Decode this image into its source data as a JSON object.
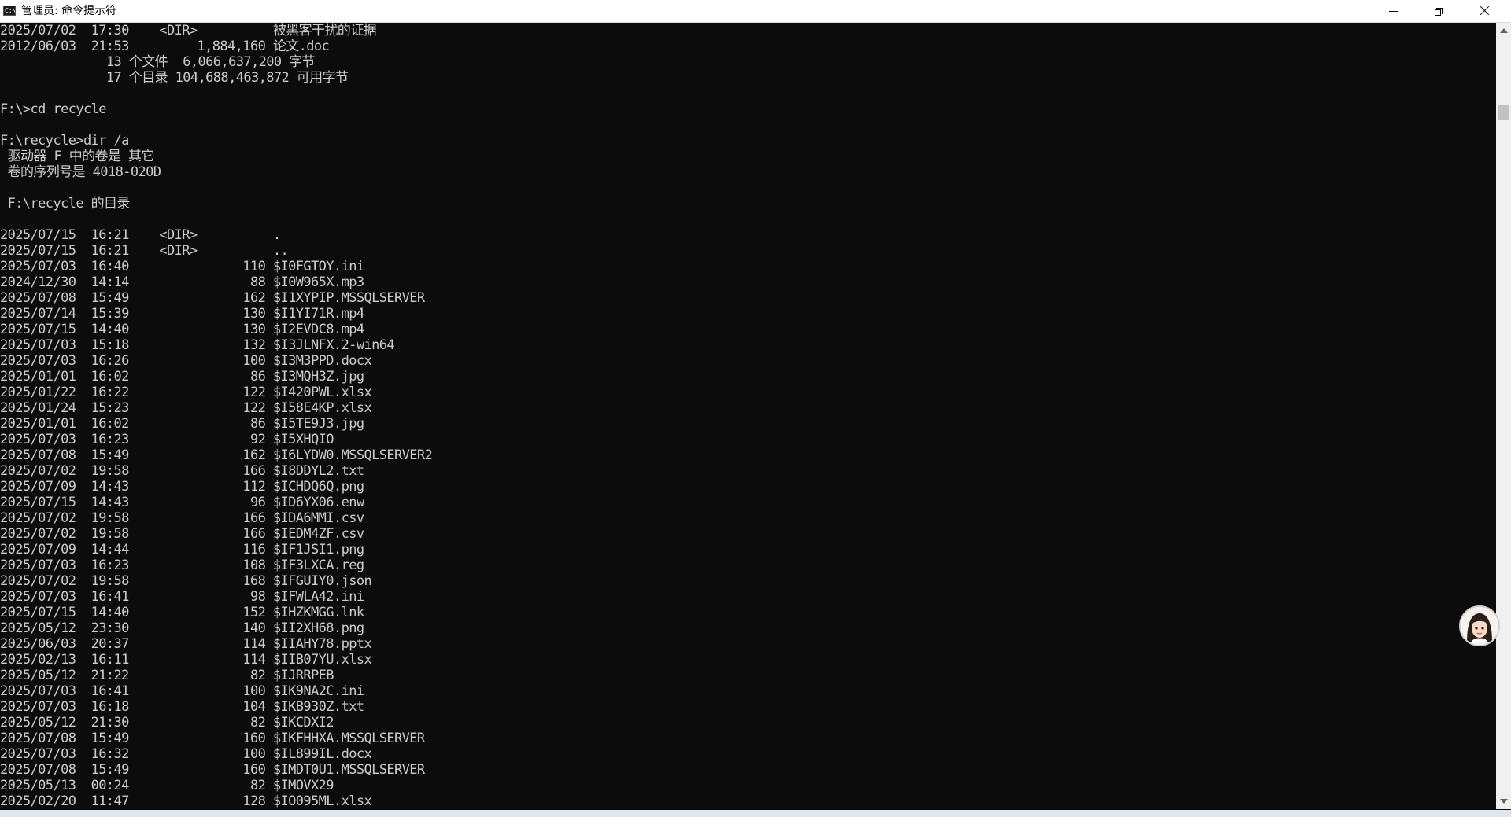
{
  "window": {
    "title": "管理员: 命令提示符",
    "app_icon_text": "C:\\",
    "icons": {
      "minimize": "minimize-icon",
      "maximize": "restore-icon",
      "close": "close-icon"
    }
  },
  "console": {
    "lines": [
      "2025/07/02  17:30    <DIR>          被黑客干扰的证据",
      "2012/06/03  21:53         1,884,160 论文.doc",
      "              13 个文件  6,066,637,200 字节",
      "              17 个目录 104,688,463,872 可用字节",
      "",
      "F:\\>cd recycle",
      "",
      "F:\\recycle>dir /a",
      " 驱动器 F 中的卷是 其它",
      " 卷的序列号是 4018-020D",
      "",
      " F:\\recycle 的目录",
      "",
      "2025/07/15  16:21    <DIR>          .",
      "2025/07/15  16:21    <DIR>          ..",
      "2025/07/03  16:40               110 $I0FGTOY.ini",
      "2024/12/30  14:14                88 $I0W965X.mp3",
      "2025/07/08  15:49               162 $I1XYPIP.MSSQLSERVER",
      "2025/07/14  15:39               130 $I1YI71R.mp4",
      "2025/07/15  14:40               130 $I2EVDC8.mp4",
      "2025/07/03  15:18               132 $I3JLNFX.2-win64",
      "2025/07/03  16:26               100 $I3M3PPD.docx",
      "2025/01/01  16:02                86 $I3MQH3Z.jpg",
      "2025/01/22  16:22               122 $I420PWL.xlsx",
      "2025/01/24  15:23               122 $I58E4KP.xlsx",
      "2025/01/01  16:02                86 $I5TE9J3.jpg",
      "2025/07/03  16:23                92 $I5XHQIO",
      "2025/07/08  15:49               162 $I6LYDW0.MSSQLSERVER2",
      "2025/07/02  19:58               166 $I8DDYL2.txt",
      "2025/07/09  14:43               112 $ICHDQ6Q.png",
      "2025/07/15  14:43                96 $ID6YX06.enw",
      "2025/07/02  19:58               166 $IDA6MMI.csv",
      "2025/07/02  19:58               166 $IEDM4ZF.csv",
      "2025/07/09  14:44               116 $IF1JSI1.png",
      "2025/07/03  16:23               108 $IF3LXCA.reg",
      "2025/07/02  19:58               168 $IFGUIY0.json",
      "2025/07/03  16:41                98 $IFWLA42.ini",
      "2025/07/15  14:40               152 $IHZKMGG.lnk",
      "2025/05/12  23:30               140 $II2XH68.png",
      "2025/06/03  20:37               114 $IIAHY78.pptx",
      "2025/02/13  16:11               114 $IIB07YU.xlsx",
      "2025/05/12  21:22                82 $IJRRPEB",
      "2025/07/03  16:41               100 $IK9NA2C.ini",
      "2025/07/03  16:18               104 $IKB930Z.txt",
      "2025/05/12  21:30                82 $IKCDXI2",
      "2025/07/08  15:49               160 $IKFHHXA.MSSQLSERVER",
      "2025/07/03  16:32               100 $IL899IL.docx",
      "2025/07/08  15:49               160 $IMDT0U1.MSSQLSERVER",
      "2025/05/13  00:24                82 $IMOVX29",
      "2025/02/20  11:47               128 $IO095ML.xlsx"
    ]
  },
  "scrollbar": {
    "icons": {
      "up": "scroll-up-arrow-icon",
      "down": "scroll-down-arrow-icon"
    }
  },
  "overlay": {
    "avatar_icon": "assistant-avatar-icon"
  }
}
